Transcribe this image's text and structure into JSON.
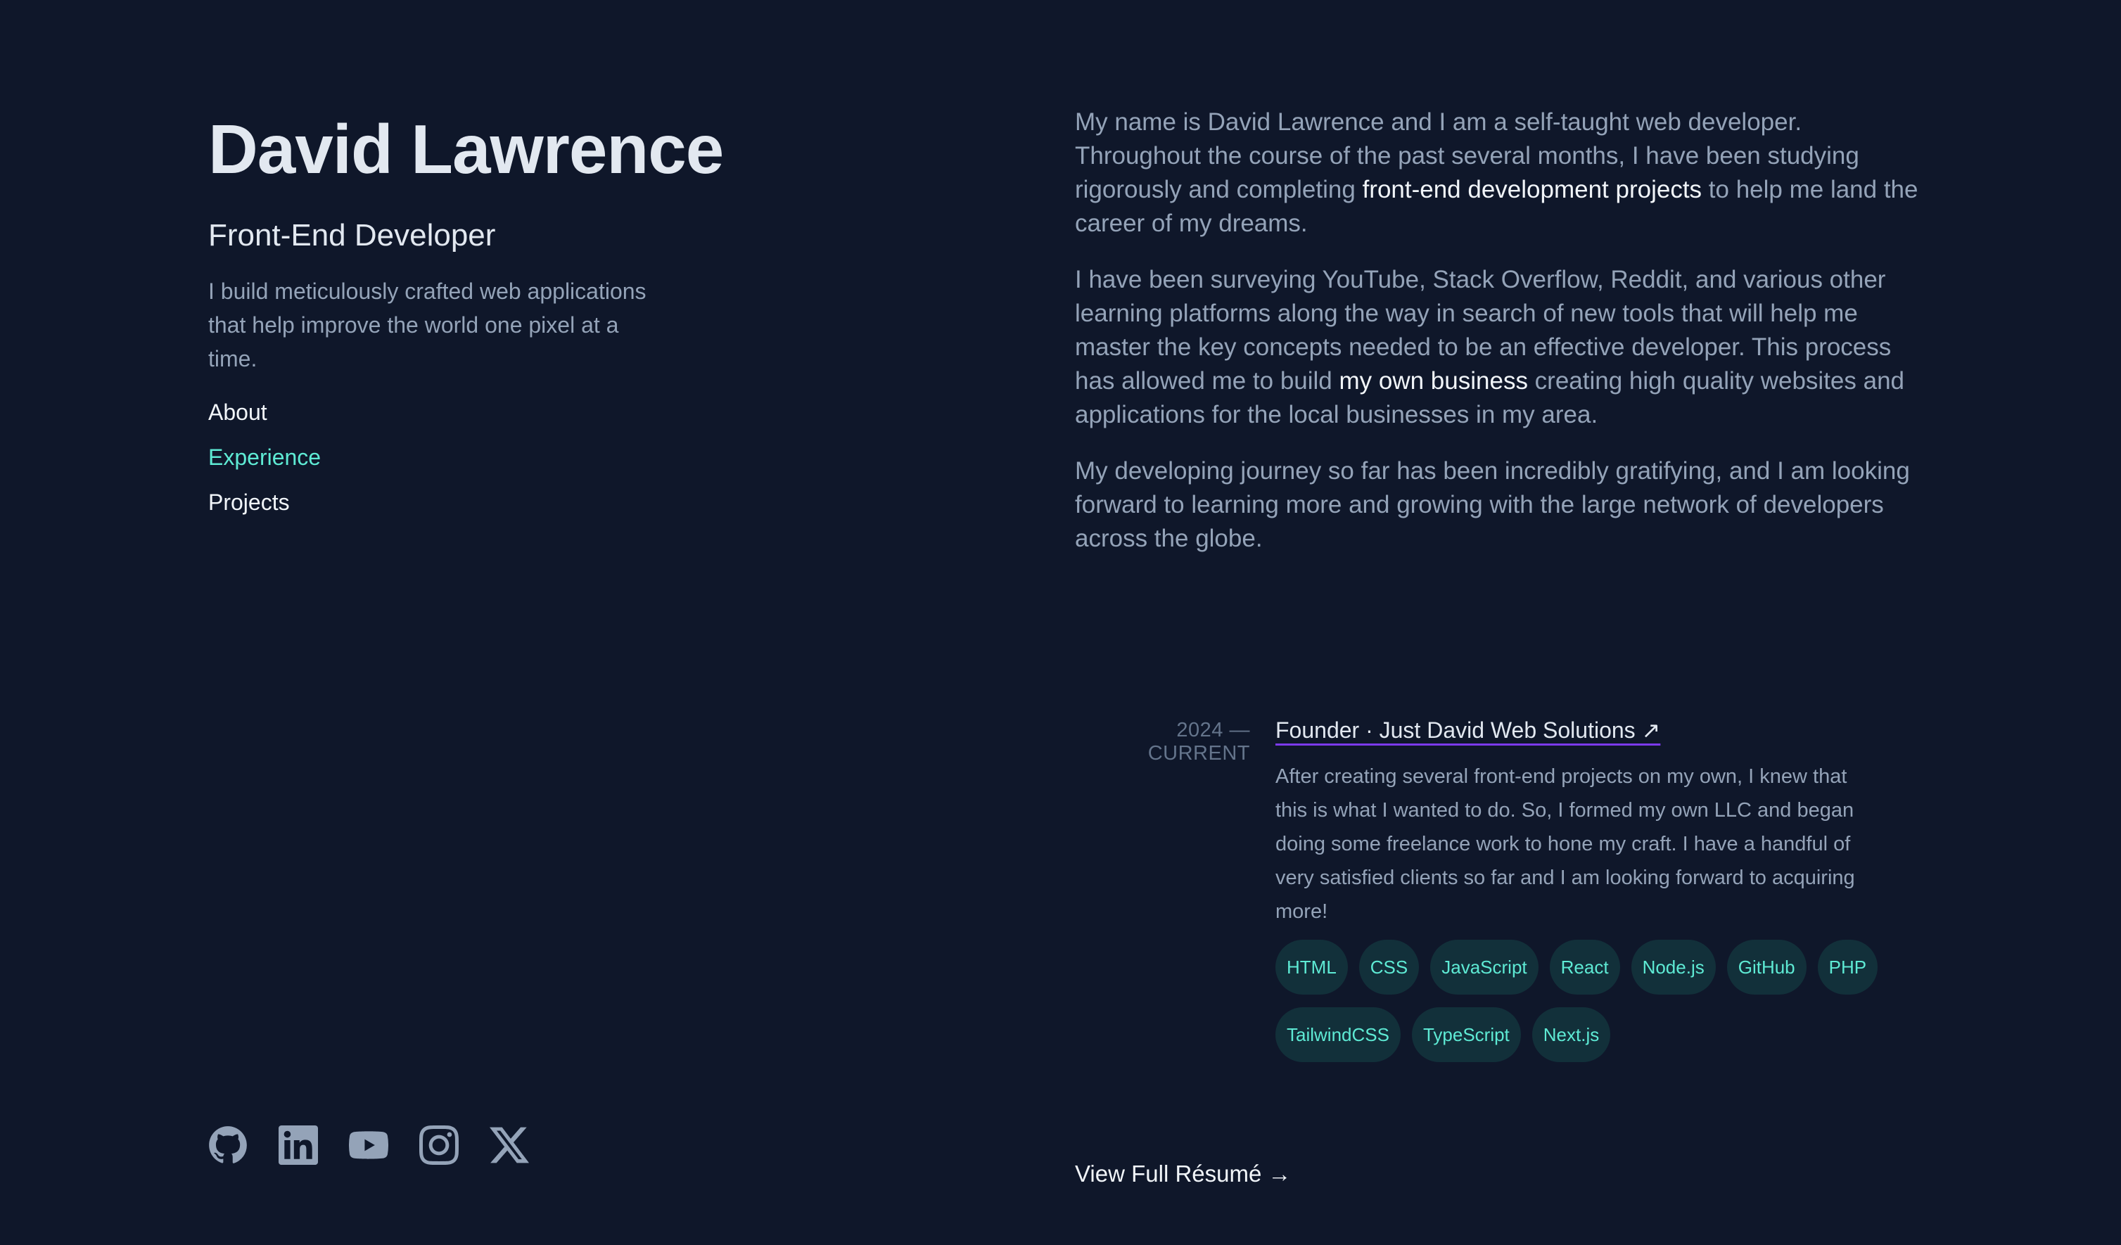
{
  "profile": {
    "name": "David Lawrence",
    "role": "Front-End Developer",
    "tagline": "I build meticulously crafted web applications that help improve the world one pixel at a time."
  },
  "nav": {
    "items": [
      "About",
      "Experience",
      "Projects"
    ],
    "active": "Experience"
  },
  "socials": [
    "github-icon",
    "linkedin-icon",
    "youtube-icon",
    "instagram-icon",
    "x-icon"
  ],
  "about": {
    "p1_a": "My name is David Lawrence and I am a self-taught web developer. Throughout the course of the past several months, I have been studying rigorously and completing ",
    "p1_link": "front-end development projects",
    "p1_b": " to help me land the career of my dreams.",
    "p2_a": "I have been surveying YouTube, Stack Overflow, Reddit, and various other learning platforms along the way in search of new tools that will help me master the key concepts needed to be an effective developer. This process has allowed me to build ",
    "p2_link": "my own business",
    "p2_b": " creating high quality websites and applications for the local businesses in my area.",
    "p3": "My developing journey so far has been incredibly gratifying, and I am looking forward to learning more and growing with the large network of developers across the globe."
  },
  "experience": {
    "date": "2024 — CURRENT",
    "title": "Founder · Just David Web Solutions ↗",
    "description": "After creating several front-end projects on my own, I knew that this is what I wanted to do. So, I formed my own LLC and began doing some freelance work to hone my craft. I have a handful of very satisfied clients so far and I am looking forward to acquiring more!",
    "tags": [
      "HTML",
      "CSS",
      "JavaScript",
      "React",
      "Node.js",
      "GitHub",
      "PHP",
      "TailwindCSS",
      "TypeScript",
      "Next.js"
    ]
  },
  "resume_link": "View Full Résumé →",
  "colors": {
    "background": "#0f172a",
    "accent": "#5eead4",
    "text": "#94a3b8",
    "heading": "#e2e8f0"
  }
}
